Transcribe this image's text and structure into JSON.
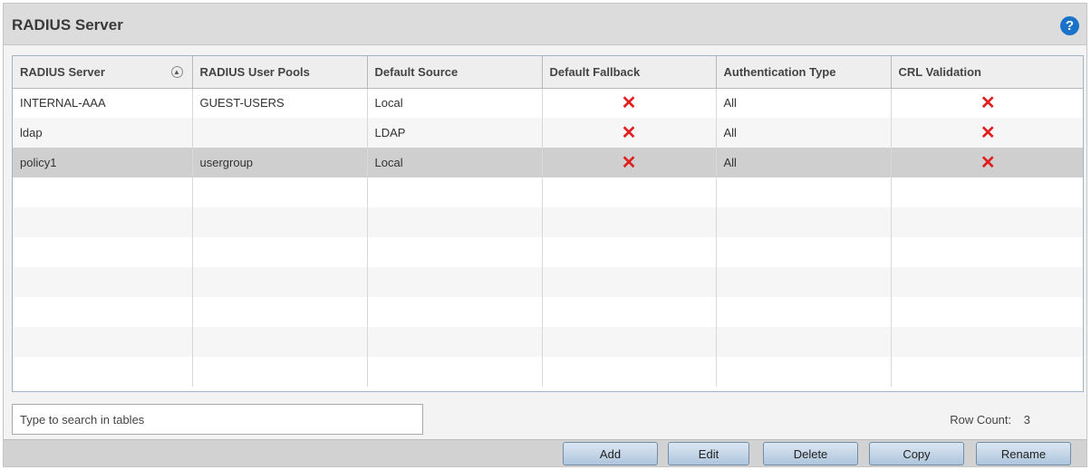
{
  "panel": {
    "title": "RADIUS Server",
    "help_icon": "?"
  },
  "table": {
    "columns": [
      "RADIUS Server",
      "RADIUS User Pools",
      "Default Source",
      "Default Fallback",
      "Authentication Type",
      "CRL Validation"
    ],
    "rows": [
      {
        "server": "INTERNAL-AAA",
        "pools": "GUEST-USERS",
        "source": "Local",
        "fallback": "✕",
        "auth": "All",
        "crl": "✕"
      },
      {
        "server": "ldap",
        "pools": "",
        "source": "LDAP",
        "fallback": "✕",
        "auth": "All",
        "crl": "✕"
      },
      {
        "server": "policy1",
        "pools": "usergroup",
        "source": "Local",
        "fallback": "✕",
        "auth": "All",
        "crl": "✕"
      }
    ],
    "sort_icon": "▲"
  },
  "search": {
    "placeholder": "Type to search in tables",
    "value": ""
  },
  "row_count": {
    "label": "Row Count:",
    "value": "3"
  },
  "buttons": {
    "add": "Add",
    "edit": "Edit",
    "delete": "Delete",
    "copy": "Copy",
    "rename": "Rename"
  },
  "colors": {
    "disabled_x": "#e02020",
    "selected_row": "#cfcfcf",
    "help": "#1a73c9"
  }
}
